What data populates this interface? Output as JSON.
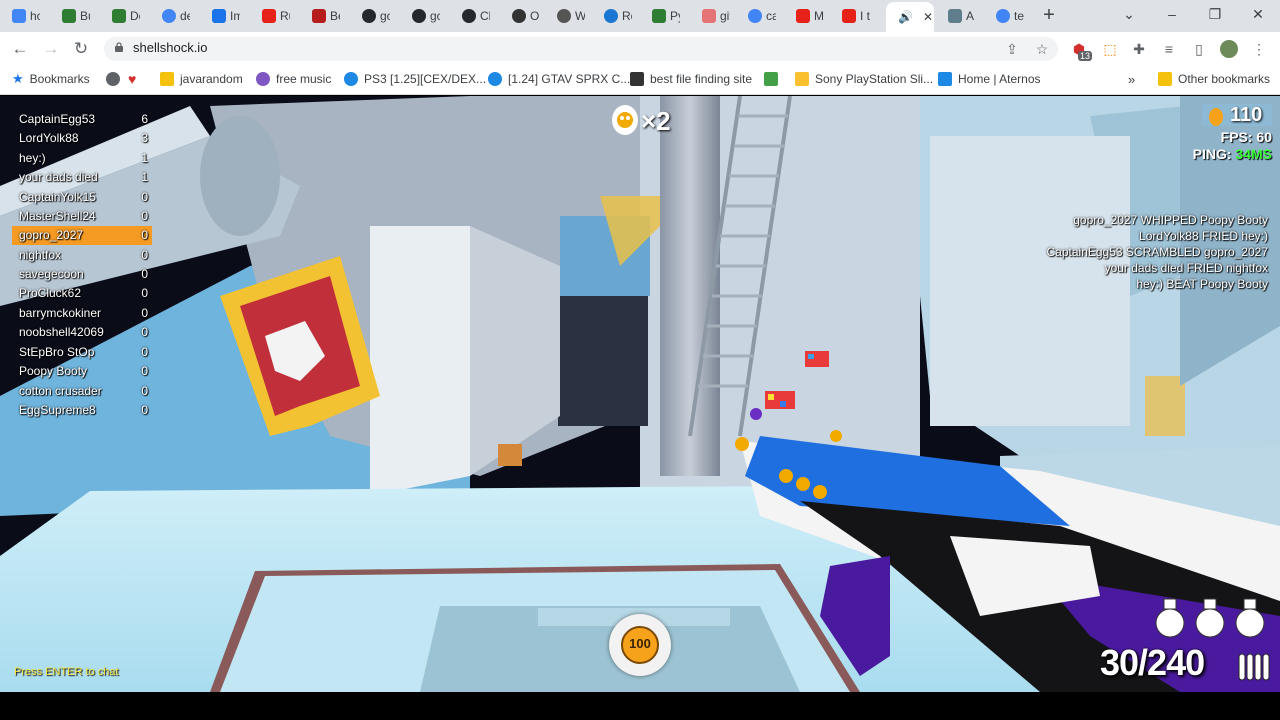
{
  "browser": {
    "tabs": [
      {
        "label": "hc",
        "color": "#4285f4"
      },
      {
        "label": "Bu",
        "color": "#2e7d32"
      },
      {
        "label": "Dc",
        "color": "#2e7d32"
      },
      {
        "label": "de",
        "color": "#4285f4"
      },
      {
        "label": "Im",
        "color": "#1a73e8"
      },
      {
        "label": "Ru",
        "color": "#e62117"
      },
      {
        "label": "Be",
        "color": "#b71c1c"
      },
      {
        "label": "gc",
        "color": "#24292e"
      },
      {
        "label": "gc",
        "color": "#24292e"
      },
      {
        "label": "Cl",
        "color": "#24292e"
      },
      {
        "label": "Op",
        "color": "#333333"
      },
      {
        "label": "W",
        "color": "#555555"
      },
      {
        "label": "Re",
        "color": "#1976d2"
      },
      {
        "label": "Py",
        "color": "#2e7d32"
      },
      {
        "label": "git",
        "color": "#e57373"
      },
      {
        "label": "ca",
        "color": "#4285f4"
      },
      {
        "label": "M",
        "color": "#e62117"
      },
      {
        "label": "I t",
        "color": "#e62117"
      },
      {
        "label": "",
        "color": "#5f6368"
      },
      {
        "label": "A",
        "color": "#607d8b"
      },
      {
        "label": "te",
        "color": "#4285f4"
      }
    ],
    "active_tab_index": 18,
    "new_tab": "+",
    "url": "shellshock.io",
    "bookmarks_bar": [
      {
        "label": "Bookmarks",
        "color": "#1a73e8"
      },
      {
        "label": "",
        "color": "#5f6368"
      },
      {
        "label": "",
        "color": "#d32f2f"
      },
      {
        "label": "javarandom",
        "color": "#f4c20d"
      },
      {
        "label": "free music",
        "color": "#7e57c2"
      },
      {
        "label": "PS3 [1.25][CEX/DEX...",
        "color": "#1e88e5"
      },
      {
        "label": "[1.24] GTAV SPRX C...",
        "color": "#1e88e5"
      },
      {
        "label": "best file finding site",
        "color": "#333333"
      },
      {
        "label": "",
        "color": "#43a047"
      },
      {
        "label": "Sony PlayStation Sli...",
        "color": "#fbc02d"
      },
      {
        "label": "Home | Aternos",
        "color": "#1e88e5"
      }
    ],
    "other_bookmarks": "Other bookmarks",
    "extension_badge": "13"
  },
  "game": {
    "scoreboard": [
      {
        "name": "CaptainEgg53",
        "score": "6"
      },
      {
        "name": "LordYolk88",
        "score": "3"
      },
      {
        "name": "hey:)",
        "score": "1"
      },
      {
        "name": "your dads died",
        "score": "1"
      },
      {
        "name": "CaptainYolk15",
        "score": "0"
      },
      {
        "name": "MasterShell24",
        "score": "0"
      },
      {
        "name": "gopro_2027",
        "score": "0"
      },
      {
        "name": "nightfox",
        "score": "0"
      },
      {
        "name": "savegecoon",
        "score": "0"
      },
      {
        "name": "ProCluck62",
        "score": "0"
      },
      {
        "name": "barrymckokiner",
        "score": "0"
      },
      {
        "name": "noobshell42069",
        "score": "0"
      },
      {
        "name": "StEpBro StOp",
        "score": "0"
      },
      {
        "name": "Poopy Booty",
        "score": "0"
      },
      {
        "name": "cotton crusader",
        "score": "0"
      },
      {
        "name": "EggSupreme8",
        "score": "0"
      }
    ],
    "highlighted_player": "gopro_2027",
    "eggs": "110",
    "fps_label": "FPS: 60",
    "ping_label": "PING:",
    "ping_value": "34MS",
    "killfeed": [
      "gopro_2027 WHIPPED Poopy Booty",
      "LordYolk88 FRIED hey:)",
      "CaptainEgg53 SCRAMBLED gopro_2027",
      "your dads died FRIED nightfox",
      "hey:) BEAT Poopy Booty"
    ],
    "streak": "×2",
    "chat_hint": "Press ENTER to chat",
    "health": "100",
    "ammo": "30/240",
    "grenades": 3,
    "colors": {
      "highlight": "#f59a23",
      "ping_good": "#3cff3c",
      "health": "#f6a21a",
      "weapon_blue": "#1f6fe0",
      "weapon_purple": "#4a1a9e"
    }
  }
}
